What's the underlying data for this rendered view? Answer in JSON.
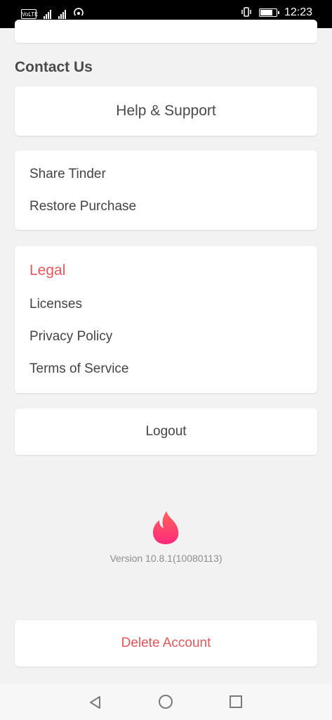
{
  "status_bar": {
    "left_badge": "VoLTE",
    "time": "12:23"
  },
  "contact": {
    "heading": "Contact Us",
    "help_label": "Help & Support"
  },
  "share_card": {
    "share_label": "Share Tinder",
    "restore_label": "Restore Purchase"
  },
  "legal": {
    "heading": "Legal",
    "licenses_label": "Licenses",
    "privacy_label": "Privacy Policy",
    "terms_label": "Terms of Service"
  },
  "logout_label": "Logout",
  "app": {
    "version": "Version 10.8.1(10080113)"
  },
  "delete_label": "Delete Account",
  "colors": {
    "accent": "#e8575a",
    "flame_top": "#ff655b",
    "flame_bottom": "#fd297b"
  }
}
